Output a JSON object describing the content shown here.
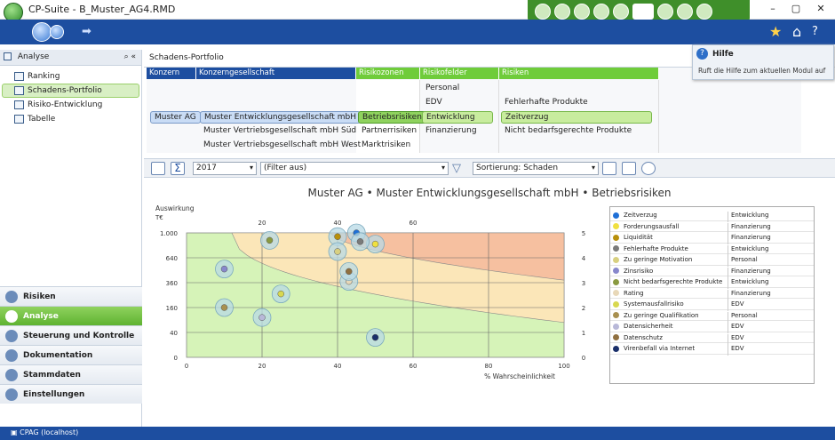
{
  "window": {
    "title": "CP-Suite - B_Muster_AG4.RMD",
    "min": "–",
    "max": "▢",
    "close": "✕"
  },
  "help": {
    "title": "Hilfe",
    "text": "Ruft die Hilfe zum aktuellen Modul auf"
  },
  "sidebar": {
    "header": "Analyse",
    "items": [
      {
        "label": "Ranking"
      },
      {
        "label": "Schadens-Portfolio",
        "selected": true
      },
      {
        "label": "Risiko-Entwicklung"
      },
      {
        "label": "Tabelle"
      }
    ]
  },
  "modules": [
    {
      "label": "Risiken"
    },
    {
      "label": "Analyse",
      "active": true
    },
    {
      "label": "Steuerung und Kontrolle"
    },
    {
      "label": "Dokumentation"
    },
    {
      "label": "Stammdaten"
    },
    {
      "label": "Einstellungen"
    }
  ],
  "status": "CPAG (localhost)",
  "main": {
    "header": "Schadens-Portfolio",
    "dims": {
      "headers": [
        "Konzern",
        "Konzerngesellschaft",
        "Risikozonen",
        "Risikofelder",
        "Risiken"
      ],
      "konzern": "Muster AG",
      "gesellschaften": [
        "Muster Entwicklungsgesellschaft mbH",
        "Muster Vertriebsgesellschaft mbH Süd",
        "Muster Vertriebsgesellschaft mbH West"
      ],
      "zonen": [
        "Betriebsrisiken",
        "Partnerrisiken",
        "Marktrisiken"
      ],
      "felder": [
        "Personal",
        "EDV",
        "Entwicklung",
        "Finanzierung"
      ],
      "risiken": [
        "Fehlerhafte Produkte",
        "Zeitverzug",
        "Nicht bedarfsgerechte Produkte"
      ]
    },
    "toolbar": {
      "year": "2017",
      "filter": "(Filter aus)",
      "sort": "Sortierung: Schaden"
    }
  },
  "chart_data": {
    "type": "scatter",
    "title": "Muster AG • Muster Entwicklungsgesellschaft mbH • Betriebsrisiken",
    "xlabel": "% Wahrscheinlichkeit",
    "ylabel": "Auswirkung",
    "yunit": "T€",
    "xlim": [
      0,
      100
    ],
    "x_ticks_bottom": [
      "0",
      "20",
      "40",
      "60",
      "80",
      "100"
    ],
    "x_ticks_top": [
      "20",
      "40",
      "60"
    ],
    "y_ticks_left": [
      "0",
      "40",
      "160",
      "360",
      "640",
      "1.000"
    ],
    "y_ticks_right": [
      "0",
      "1",
      "2",
      "3",
      "4",
      "5"
    ],
    "zone_colors": {
      "low": "#d6f3b8",
      "mid": "#fbe6b8",
      "high": "#f6c0a0"
    },
    "points": [
      {
        "name": "Zeitverzug",
        "category": "Entwicklung",
        "color": "#1f6fd6",
        "x": 45,
        "y": 5.0
      },
      {
        "name": "Forderungsausfall",
        "category": "Finanzierung",
        "color": "#f0e040",
        "x": 50,
        "y": 4.55
      },
      {
        "name": "Liquidität",
        "category": "Finanzierung",
        "color": "#b8900c",
        "x": 40,
        "y": 4.85
      },
      {
        "name": "Fehlerhafte Produkte",
        "category": "Entwicklung",
        "color": "#7a7a7a",
        "x": 46,
        "y": 4.65
      },
      {
        "name": "Zu geringe Motivation",
        "category": "Personal",
        "color": "#d8d080",
        "x": 40,
        "y": 4.25
      },
      {
        "name": "Zinsrisiko",
        "category": "Finanzierung",
        "color": "#8888cc",
        "x": 10,
        "y": 3.55
      },
      {
        "name": "Nicht bedarfsgerechte Produkte",
        "category": "Entwicklung",
        "color": "#8a9a40",
        "x": 22,
        "y": 4.7
      },
      {
        "name": "Rating",
        "category": "Finanzierung",
        "color": "#e8d8b8",
        "x": 43,
        "y": 3.05
      },
      {
        "name": "Systemausfallrisiko",
        "category": "EDV",
        "color": "#d8d850",
        "x": 25,
        "y": 2.55
      },
      {
        "name": "Zu geringe Qualifikation",
        "category": "Personal",
        "color": "#a89050",
        "x": 10,
        "y": 2.0
      },
      {
        "name": "Datensicherheit",
        "category": "EDV",
        "color": "#b8b8d8",
        "x": 20,
        "y": 1.6
      },
      {
        "name": "Datenschutz",
        "category": "EDV",
        "color": "#907040",
        "x": 43,
        "y": 3.45
      },
      {
        "name": "Virenbefall via Internet",
        "category": "EDV",
        "color": "#1a2f6a",
        "x": 50,
        "y": 0.8
      }
    ]
  }
}
